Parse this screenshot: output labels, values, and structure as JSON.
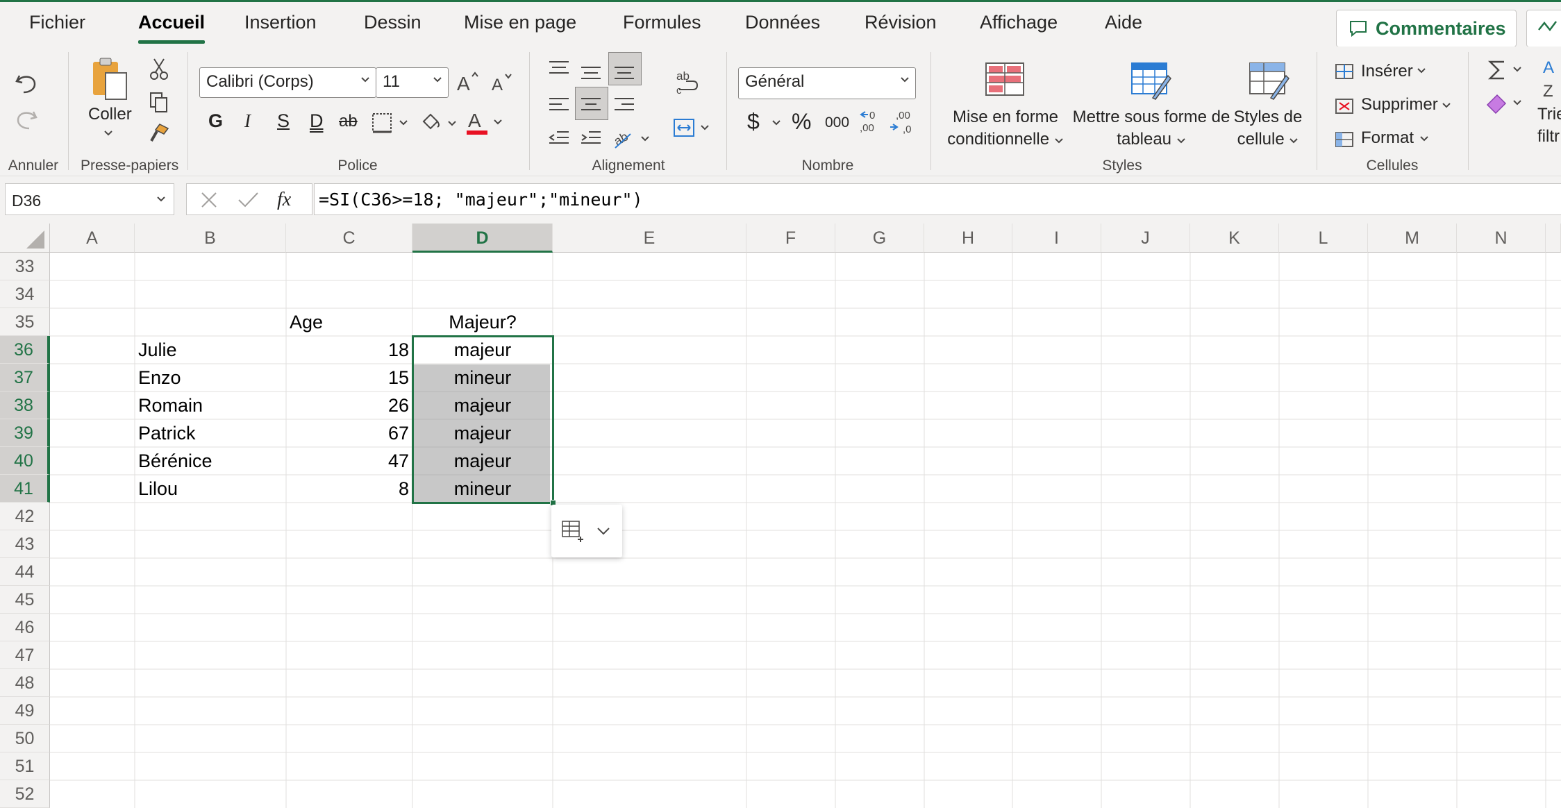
{
  "tabs": [
    "Fichier",
    "Accueil",
    "Insertion",
    "Dessin",
    "Mise en page",
    "Formules",
    "Données",
    "Révision",
    "Affichage",
    "Aide"
  ],
  "active_tab": "Accueil",
  "comments_label": "Commentaires",
  "ribbon": {
    "annuler": {
      "group": "Annuler"
    },
    "presse_papiers": {
      "coller": "Coller",
      "group": "Presse-papiers"
    },
    "police": {
      "font": "Calibri (Corps)",
      "size": "11",
      "bold": "G",
      "italic": "I",
      "underline": "S",
      "double_underline": "D",
      "strike": "ab",
      "group": "Police"
    },
    "alignement": {
      "group": "Alignement"
    },
    "nombre": {
      "format": "Général",
      "currency": "$",
      "percent": "%",
      "thousands": "000",
      "group": "Nombre"
    },
    "styles": {
      "cond_line1": "Mise en forme",
      "cond_line2": "conditionnelle",
      "table_line1": "Mettre sous forme de",
      "table_line2": "tableau",
      "cell_line1": "Styles de",
      "cell_line2": "cellule",
      "group": "Styles"
    },
    "cellules": {
      "inserer": "Insérer",
      "supprimer": "Supprimer",
      "format": "Format",
      "group": "Cellules"
    },
    "edition": {
      "sort_line1": "Trier",
      "sort_line2": "filtr"
    }
  },
  "formula_bar": {
    "name_box": "D36",
    "fx": "fx",
    "formula": "=SI(C36>=18; \"majeur\";\"mineur\")"
  },
  "columns": [
    "A",
    "B",
    "C",
    "D",
    "E",
    "F",
    "G",
    "H",
    "I",
    "J",
    "K",
    "L",
    "M",
    "N"
  ],
  "selected_column": "D",
  "rows": [
    "33",
    "34",
    "35",
    "36",
    "37",
    "38",
    "39",
    "40",
    "41",
    "42",
    "43",
    "44",
    "45",
    "46",
    "47",
    "48",
    "49",
    "50",
    "51",
    "52"
  ],
  "selected_rows": [
    "36",
    "37",
    "38",
    "39",
    "40",
    "41"
  ],
  "headers": {
    "age": "Age",
    "majeur": "Majeur?"
  },
  "people": [
    {
      "name": "Julie",
      "age": "18",
      "status": "majeur"
    },
    {
      "name": "Enzo",
      "age": "15",
      "status": "mineur"
    },
    {
      "name": "Romain",
      "age": "26",
      "status": "majeur"
    },
    {
      "name": "Patrick",
      "age": "67",
      "status": "majeur"
    },
    {
      "name": "Bérénice",
      "age": "47",
      "status": "majeur"
    },
    {
      "name": "Lilou",
      "age": "8",
      "status": "mineur"
    }
  ],
  "colors": {
    "accent": "#217346",
    "selection_fill": "#c8c8c8",
    "font_color_bar": "#e81123"
  }
}
